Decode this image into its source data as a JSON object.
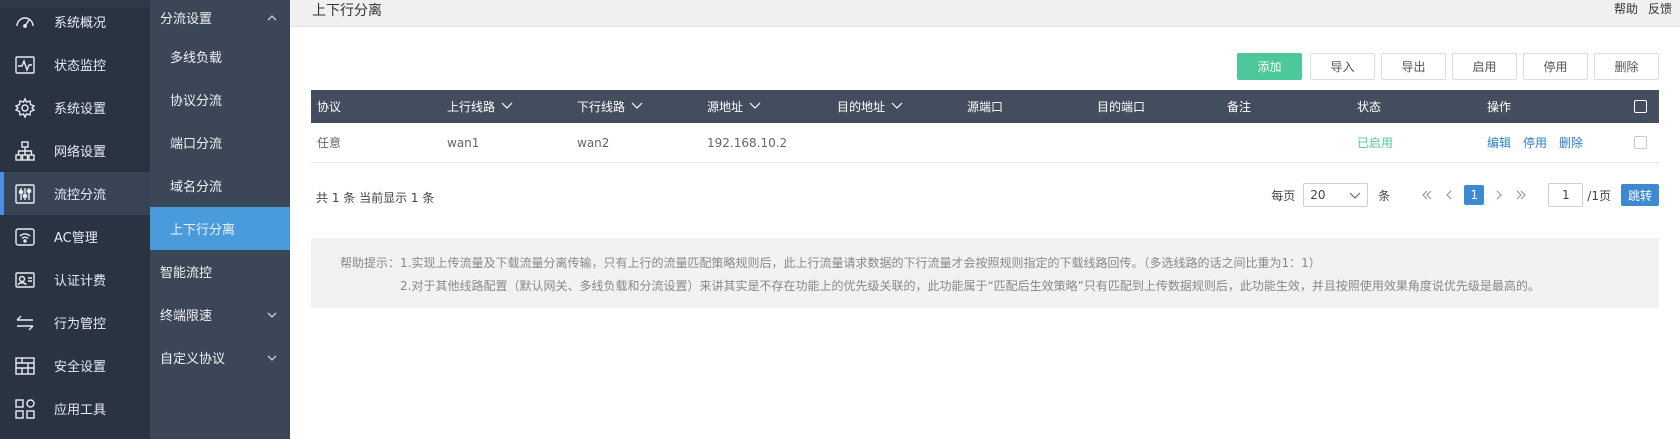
{
  "topbar": {
    "title": "上下行分离",
    "help": "帮助",
    "feedback": "反馈"
  },
  "nav1": [
    {
      "label": "系统概况",
      "icon": "dashboard-icon"
    },
    {
      "label": "状态监控",
      "icon": "pulse-icon"
    },
    {
      "label": "系统设置",
      "icon": "gear-icon"
    },
    {
      "label": "网络设置",
      "icon": "network-icon"
    },
    {
      "label": "流控分流",
      "icon": "sliders-icon"
    },
    {
      "label": "AC管理",
      "icon": "wifi-icon"
    },
    {
      "label": "认证计费",
      "icon": "id-card-icon"
    },
    {
      "label": "行为管控",
      "icon": "swap-arrows-icon"
    },
    {
      "label": "安全设置",
      "icon": "firewall-icon"
    },
    {
      "label": "应用工具",
      "icon": "apps-icon"
    }
  ],
  "nav2": [
    {
      "label": "分流设置",
      "expand": "up"
    },
    {
      "label": "多线负载"
    },
    {
      "label": "协议分流"
    },
    {
      "label": "端口分流"
    },
    {
      "label": "域名分流"
    },
    {
      "label": "上下行分离"
    },
    {
      "label": "智能流控"
    },
    {
      "label": "终端限速",
      "expand": "down"
    },
    {
      "label": "自定义协议",
      "expand": "down"
    }
  ],
  "toolbar": {
    "add": "添加",
    "import": "导入",
    "export": "导出",
    "enable": "启用",
    "disable": "停用",
    "delete": "删除"
  },
  "table": {
    "headers": [
      "协议",
      "上行线路",
      "下行线路",
      "源地址",
      "目的地址",
      "源端口",
      "目的端口",
      "备注",
      "状态",
      "操作"
    ],
    "rows": [
      {
        "protocol": "任意",
        "up_line": "wan1",
        "down_line": "wan2",
        "src_addr": "192.168.10.2",
        "dst_addr": "",
        "src_port": "",
        "dst_port": "",
        "note": "",
        "status": "已启用",
        "op_edit": "编辑",
        "op_disable": "停用",
        "op_delete": "删除"
      }
    ]
  },
  "summary": "共 1 条 当前显示 1 条",
  "pager": {
    "per_page_label": "每页",
    "per_page_value": "20",
    "unit": "条",
    "current_page": "1",
    "goto_value": "1",
    "total_pages": "/1页",
    "jump": "跳转"
  },
  "help": {
    "line1": "帮助提示：1.实现上传流量及下载流量分离传输，只有上行的流量匹配策略规则后，此上行流量请求数据的下行流量才会按照规则指定的下载线路回传。（多选线路的话之间比重为1：1）",
    "line2": "2.对于其他线路配置（默认网关、多线负载和分流设置）来讲其实是不存在功能上的优先级关联的，此功能属于“匹配后生效策略”只有匹配到上传数据规则后，此功能生效，并且按照使用效果角度说优先级是最高的。"
  },
  "colors": {
    "sidebar_dark": "#2a3342",
    "sidebar_sub": "#3b4656",
    "active_blue": "#4a9bdb",
    "add_green": "#4cc89a",
    "table_head": "#444d5e"
  }
}
